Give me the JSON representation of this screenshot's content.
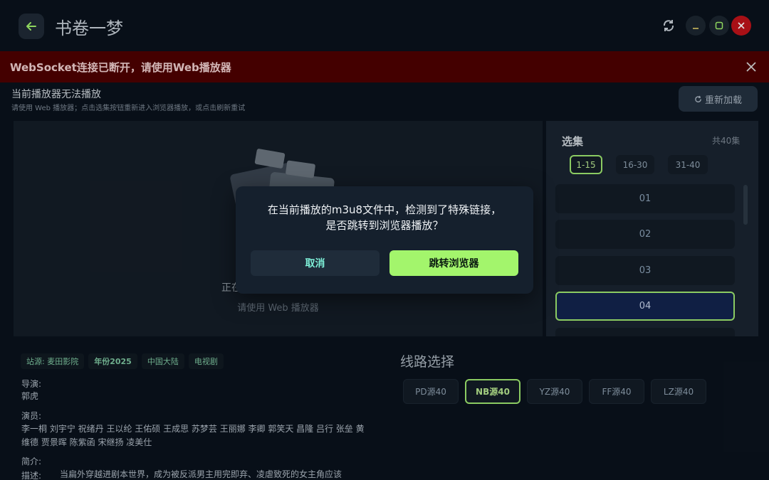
{
  "app": {
    "title": "书卷一梦"
  },
  "banner": {
    "text": "WebSocket连接已断开，请使用Web播放器"
  },
  "player": {
    "header_title": "当前播放器无法播放",
    "header_subtitle": "请使用 Web 播放器；点击选集按钮重新进入浏览器播放，或点击刷新重试",
    "reload_label": "重新加载",
    "status_text": "正在",
    "hint_text": "请使用 Web 播放器"
  },
  "episodes": {
    "title": "选集",
    "count": "共40集",
    "ranges": [
      "1-15",
      "16-30",
      "31-40"
    ],
    "active_range": 0,
    "items": [
      "01",
      "02",
      "03",
      "04"
    ],
    "active_item": 3
  },
  "info": {
    "tags": [
      "站源: 麦田影院",
      "年份2025",
      "中国大陆",
      "电视剧"
    ],
    "director_label": "导演:",
    "director": "郭虎",
    "cast_label": "演员:",
    "cast": "李一桐 刘宇宁 祝绪丹 王以纶 王佑硕 王成思 苏梦芸 王丽娜 李卿 郭笑天 昌隆 吕行 张垒 黄维德 贾景晖 陈紫函 宋继扬 凌美仕",
    "intro_label": "简介:",
    "desc_label": "描述:",
    "desc": "当扁外穿越进剧本世界，成为被反派男主用完即弃、凌虐致死的女主角应该"
  },
  "routes": {
    "title": "线路选择",
    "items": [
      "PD源40",
      "NB源40",
      "YZ源40",
      "FF源40",
      "LZ源40"
    ],
    "active": 1
  },
  "dialog": {
    "message_line1": "在当前播放的m3u8文件中，检测到了特殊链接，",
    "message_line2": "是否跳转到浏览器播放？",
    "cancel_label": "取消",
    "confirm_label": "跳转浏览器"
  },
  "colors": {
    "accent": "#a3f56c",
    "banner_bg": "#4e0000",
    "close_red": "#c0131a",
    "episode_active_bg": "#13244e"
  }
}
